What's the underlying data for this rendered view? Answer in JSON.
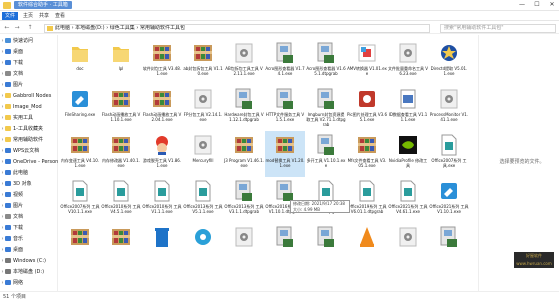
{
  "window": {
    "title": "软件综合助手 · 工具箱",
    "controls": {
      "minimize": "—",
      "maximize": "☐",
      "close": "✕"
    }
  },
  "ribbon": {
    "tabs": [
      "文件",
      "主页",
      "共享",
      "查看"
    ]
  },
  "address": {
    "back": "←",
    "forward": "→",
    "up": "↑",
    "path": "此电脑 › 本地磁盘(D:) › 绿色工具集 › 常用辅助软件工具包",
    "search_placeholder": "搜索\"常用辅助软件工具包\""
  },
  "sidebar": {
    "items": [
      {
        "label": "快速访问",
        "icon": "star-icon",
        "color": "#4a90d9"
      },
      {
        "label": "桌面",
        "icon": "desktop-icon",
        "color": "#3a7bd5"
      },
      {
        "label": "下载",
        "icon": "download-icon",
        "color": "#3a7bd5"
      },
      {
        "label": "文档",
        "icon": "document-icon",
        "color": "#8a8a8a"
      },
      {
        "label": "图片",
        "icon": "picture-icon",
        "color": "#3a7bd5"
      },
      {
        "label": "Gabbroll Nodes",
        "icon": "folder-icon",
        "color": "#f2c94c"
      },
      {
        "label": "Image_Mod",
        "icon": "folder-icon",
        "color": "#f2c94c"
      },
      {
        "label": "实用工具",
        "icon": "folder-icon",
        "color": "#f2c94c"
      },
      {
        "label": "1-工具收藏夹",
        "icon": "folder-icon",
        "color": "#f2c94c"
      },
      {
        "label": "常用辅助软件",
        "icon": "folder-icon",
        "color": "#f2c94c"
      },
      {
        "label": "WPS云文档",
        "icon": "cloud-icon",
        "color": "#3a7bd5"
      },
      {
        "label": "OneDrive - Persona",
        "icon": "onedrive-icon",
        "color": "#3a7bd5"
      },
      {
        "label": "此电脑",
        "icon": "pc-icon",
        "color": "#3a7bd5"
      },
      {
        "label": "3D 对象",
        "icon": "cube-icon",
        "color": "#3a7bd5"
      },
      {
        "label": "视频",
        "icon": "video-icon",
        "color": "#3a7bd5"
      },
      {
        "label": "图片",
        "icon": "picture-icon",
        "color": "#3a7bd5"
      },
      {
        "label": "文档",
        "icon": "document-icon",
        "color": "#8a8a8a"
      },
      {
        "label": "下载",
        "icon": "download-icon",
        "color": "#3a7bd5"
      },
      {
        "label": "音乐",
        "icon": "music-icon",
        "color": "#3a7bd5"
      },
      {
        "label": "桌面",
        "icon": "desktop-icon",
        "color": "#3a7bd5"
      },
      {
        "label": "Windows (C:)",
        "icon": "drive-icon",
        "color": "#777"
      },
      {
        "label": "本地磁盘 (D:)",
        "icon": "drive-icon",
        "color": "#777"
      },
      {
        "label": "网络",
        "icon": "network-icon",
        "color": "#3a7bd5"
      }
    ]
  },
  "files": [
    {
      "label": "doc",
      "kind": "folder"
    },
    {
      "label": "lpl",
      "kind": "folder"
    },
    {
      "label": "软件封包工具 V3.48.1.exe",
      "kind": "winrar"
    },
    {
      "label": "ab封包拆包工具 V1.10.exe",
      "kind": "winrar"
    },
    {
      "label": "AB包拆包工具工具 V2.11.1.exe",
      "kind": "setup"
    },
    {
      "label": "Acro图形查看器 V1.74.1.exe",
      "kind": "installer"
    },
    {
      "label": "Acro图形查看器 V1.65.1.dtpgrab",
      "kind": "installer"
    },
    {
      "label": "AMV转换器 V1.01.exe",
      "kind": "amv"
    },
    {
      "label": "文件批量重命名工具 V6.23.exe",
      "kind": "setup"
    },
    {
      "label": "Directd提取 V5.01.1.exe",
      "kind": "star"
    },
    {
      "label": "FileSharing.exe",
      "kind": "tools"
    },
    {
      "label": "Flash动画播放工具 V1.10.1.exe",
      "kind": "winrar"
    },
    {
      "label": "Flash动画播放工具 V2.04.1.exe",
      "kind": "winrar"
    },
    {
      "label": "FP分包工具 V2.14.1.exe",
      "kind": "setup"
    },
    {
      "label": "Hardware封包工具 V1.12.1.dtpgrab",
      "kind": "installer"
    },
    {
      "label": "HTTP文件服务工具 V1.5.1.exe",
      "kind": "installer"
    },
    {
      "label": "Imgburn封包资源提取工具 V2.71.1.dtpgrab",
      "kind": "installer"
    },
    {
      "label": "Pic图片处理工具 V3.65.1.exe",
      "kind": "red"
    },
    {
      "label": "ID数据查看工具 V1.11.1.exe",
      "kind": "pdf"
    },
    {
      "label": "ProcessMonitor V1.41.1.exe",
      "kind": "setup"
    },
    {
      "label": "内存变速工具 V4.10.1.exe",
      "kind": "winrar"
    },
    {
      "label": "内存修改器 V1.40.1.exe",
      "kind": "winrar"
    },
    {
      "label": "游戏脱壳工具 V1.86.1.exe",
      "kind": "mario"
    },
    {
      "label": "Mercuryfill",
      "kind": "setup"
    },
    {
      "label": "J3 Program V1.46.1.exe",
      "kind": "winrar"
    },
    {
      "label": "mod替换工具 V1.20.1.exe",
      "kind": "winrar"
    },
    {
      "label": "多开工具 V1.10.1.exe",
      "kind": "installer"
    },
    {
      "label": "Mfs文件查看工具 V3.05.1.exe",
      "kind": "winrar"
    },
    {
      "label": "NvidiaProfile 修改工具",
      "kind": "nvidia"
    },
    {
      "label": "Office2007系列 工具.exe",
      "kind": "doc"
    },
    {
      "label": "Office2007系列 工具 V10.1.1.exe",
      "kind": "doc"
    },
    {
      "label": "Office2010系列 工具 V4.5.1.exe",
      "kind": "doc"
    },
    {
      "label": "Office2010系列 工具 V1.1.1.exe",
      "kind": "doc"
    },
    {
      "label": "Office2013系列 工具 V5.1.1.exe",
      "kind": "doc"
    },
    {
      "label": "Office2013系列 工具 V3.1.1.dtpgrab",
      "kind": "installer"
    },
    {
      "label": "Office2016系列 工具 V1.10.1.dtpgrab",
      "kind": "installer"
    },
    {
      "label": "Office2016系列 工具 V1.1.1.dtpgrab",
      "kind": "doc"
    },
    {
      "label": "Office2019系列 工具 V6.01.1.dtpgrab",
      "kind": "doc"
    },
    {
      "label": "Office2021系列 工具 V4.61.1.exe",
      "kind": "doc"
    },
    {
      "label": "Office2021系列 工具 V1.10.1.exe",
      "kind": "tools"
    },
    {
      "label": "",
      "kind": "winrar"
    },
    {
      "label": "",
      "kind": "winrar"
    },
    {
      "label": "",
      "kind": "bin"
    },
    {
      "label": "",
      "kind": "ball"
    },
    {
      "label": "",
      "kind": "setup"
    },
    {
      "label": "",
      "kind": "installer"
    },
    {
      "label": "",
      "kind": "installer"
    },
    {
      "label": "",
      "kind": "vlc"
    },
    {
      "label": "",
      "kind": "setup"
    },
    {
      "label": "",
      "kind": "installer"
    }
  ],
  "tooltip": {
    "line1": "修改日期: 2021/9/17 20:38",
    "line2": "大小: 4.99 MB"
  },
  "preview": {
    "text": "选择要预览的文件。"
  },
  "status": {
    "text": "51 个项目"
  },
  "watermark": {
    "line1": "好屋软件",
    "line2": "www.hwruan.com"
  }
}
